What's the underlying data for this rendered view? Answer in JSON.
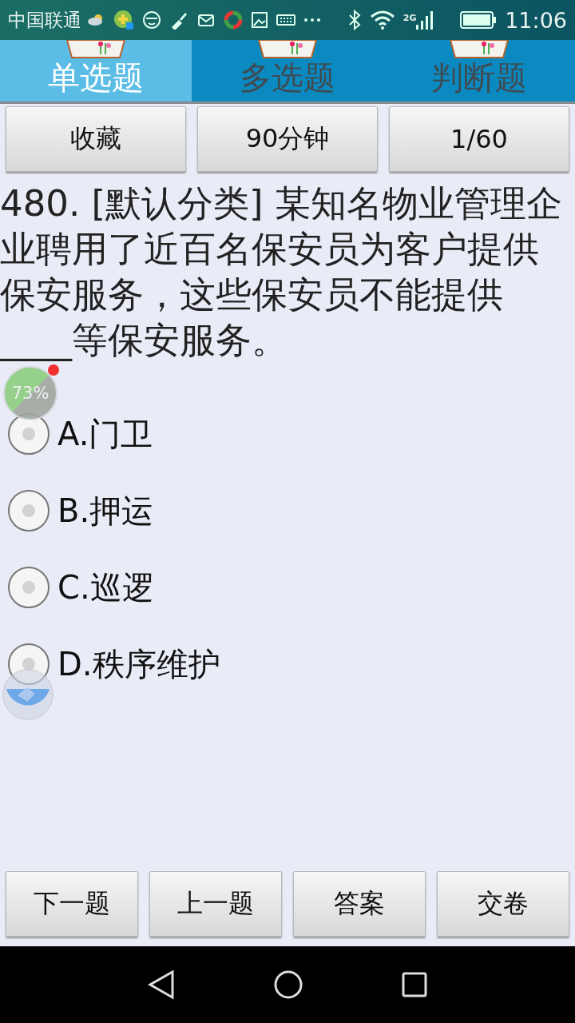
{
  "status_bar": {
    "carrier": "中国联通",
    "network": "2G",
    "time": "11:06"
  },
  "tabs": [
    {
      "label": "单选题",
      "selected": true
    },
    {
      "label": "多选题",
      "selected": false
    },
    {
      "label": "判断题",
      "selected": false
    }
  ],
  "top_buttons": [
    "收藏",
    "90分钟",
    "1/60"
  ],
  "question": "480. [默认分类] 某知名物业管理企业聘用了近百名保安员为客户提供保安服务，这些保安员不能提供____等保安服务。",
  "options": [
    {
      "label": "A.门卫",
      "selected": false
    },
    {
      "label": "B.押运",
      "selected": false
    },
    {
      "label": "C.巡逻",
      "selected": false
    },
    {
      "label": "D.秩序维护",
      "selected": false
    }
  ],
  "floating_meter": {
    "label": "73%"
  },
  "bottom_buttons": [
    "下一题",
    "上一题",
    "答案",
    "交卷"
  ]
}
